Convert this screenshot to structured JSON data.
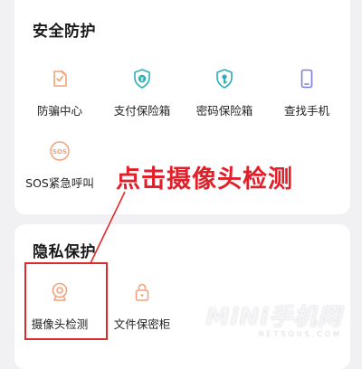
{
  "security": {
    "title": "安全防护",
    "items": [
      {
        "label": "防骗中心",
        "icon": "fraud-center-icon"
      },
      {
        "label": "支付保险箱",
        "icon": "payment-safe-icon"
      },
      {
        "label": "密码保险箱",
        "icon": "password-safe-icon"
      },
      {
        "label": "查找手机",
        "icon": "find-phone-icon"
      },
      {
        "label": "SOS紧急呼叫",
        "icon": "sos-icon"
      }
    ]
  },
  "privacy": {
    "title": "隐私保护",
    "items": [
      {
        "label": "摄像头检测",
        "icon": "camera-detect-icon"
      },
      {
        "label": "文件保密柜",
        "icon": "file-locker-icon"
      }
    ]
  },
  "annotation": {
    "text": "点击摄像头检测"
  },
  "watermark": {
    "main": "MiNi手机网",
    "sub": "NETSOUS.COM"
  },
  "colors": {
    "accent": "#f2a37a",
    "annotation": "#e0202a",
    "background": "#f1f1f3",
    "card": "#ffffff"
  }
}
